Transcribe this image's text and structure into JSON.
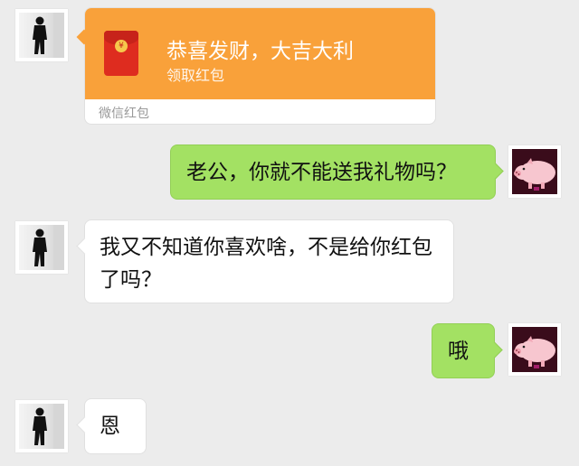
{
  "red_packet": {
    "title": "恭喜发财，大吉大利",
    "subtitle": "领取红包",
    "footer": "微信红包",
    "coin_symbol": "¥",
    "color_orange": "#f9a13a",
    "color_red": "#de2c1f"
  },
  "messages": [
    {
      "side": "right",
      "text": "老公，你就不能送我礼物吗？"
    },
    {
      "side": "left",
      "text": "我又不知道你喜欢啥，不是给你红包了吗？"
    },
    {
      "side": "right",
      "text": "哦"
    },
    {
      "side": "left",
      "text": "恩"
    }
  ],
  "colors": {
    "background": "#ececec",
    "bubble_green": "#a3e163",
    "bubble_white": "#ffffff"
  },
  "avatars": {
    "contact": "man-avatar-icon",
    "self": "pig-avatar-icon"
  }
}
